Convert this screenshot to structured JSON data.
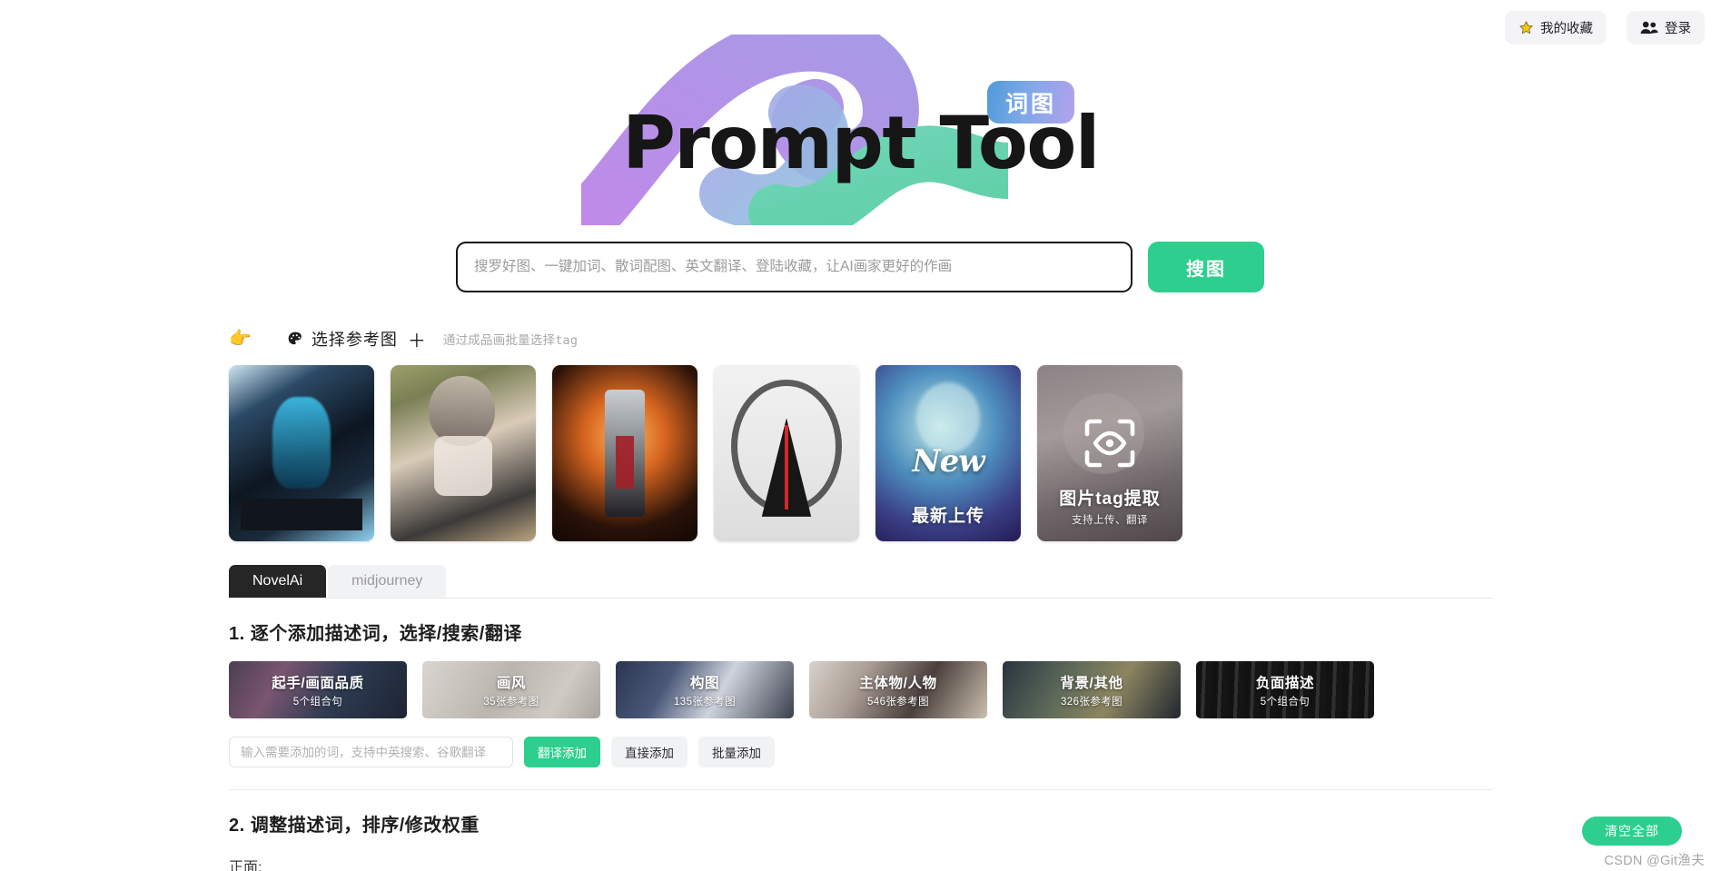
{
  "topbar": {
    "favorites": {
      "label": "我的收藏",
      "icon": "star-icon"
    },
    "login": {
      "label": "登录",
      "icon": "users-icon"
    }
  },
  "hero": {
    "title": "Prompt Tool",
    "badge": "词图",
    "blob_purple": "#b07fe0",
    "blob_blue": "#8fb9dd",
    "blob_green": "#5fd3ab"
  },
  "search": {
    "placeholder": "搜罗好图、一键加词、散词配图、英文翻译、登陆收藏，让AI画家更好的作画",
    "value": "",
    "button": "搜图",
    "accent": "#2ecf8e"
  },
  "pick": {
    "hand_icon": "pointing-hand-icon",
    "palette_icon": "palette-icon",
    "title": "选择参考图",
    "plus": "＋",
    "hint": "通过成品画批量选择tag"
  },
  "reference_cards": [
    {
      "name": "ref-card-1",
      "caption": "",
      "subcaption": "",
      "kind": "image"
    },
    {
      "name": "ref-card-2",
      "caption": "",
      "subcaption": "",
      "kind": "image"
    },
    {
      "name": "ref-card-3",
      "caption": "",
      "subcaption": "",
      "kind": "image"
    },
    {
      "name": "ref-card-4",
      "caption": "",
      "subcaption": "",
      "kind": "image"
    },
    {
      "name": "ref-card-new-upload",
      "caption": "最新上传",
      "subcaption": "",
      "badge": "New",
      "kind": "new"
    },
    {
      "name": "ref-card-tag-extract",
      "caption": "图片tag提取",
      "subcaption": "支持上传、翻译",
      "icon": "eye-scan-icon",
      "kind": "extract"
    }
  ],
  "tabs": [
    {
      "label": "NovelAi",
      "active": true
    },
    {
      "label": "midjourney",
      "active": false
    }
  ],
  "step1": {
    "title": "1. 逐个添加描述词，选择/搜索/翻译"
  },
  "categories": [
    {
      "name": "起手/画面品质",
      "count": "5个组合句"
    },
    {
      "name": "画风",
      "count": "35张参考图"
    },
    {
      "name": "构图",
      "count": "135张参考图"
    },
    {
      "name": "主体物/人物",
      "count": "546张参考图"
    },
    {
      "name": "背景/其他",
      "count": "326张参考图"
    },
    {
      "name": "负面描述",
      "count": "5个组合句"
    }
  ],
  "add_row": {
    "placeholder": "输入需要添加的词，支持中英搜索、谷歌翻译",
    "value": "",
    "translate_add": "翻译添加",
    "direct_add": "直接添加",
    "batch_add": "批量添加"
  },
  "step2": {
    "title": "2. 调整描述词，排序/修改权重",
    "positive_label": "正面:"
  },
  "footer": {
    "clear_all": "清空全部",
    "watermark": "CSDN @Git渔夫"
  }
}
